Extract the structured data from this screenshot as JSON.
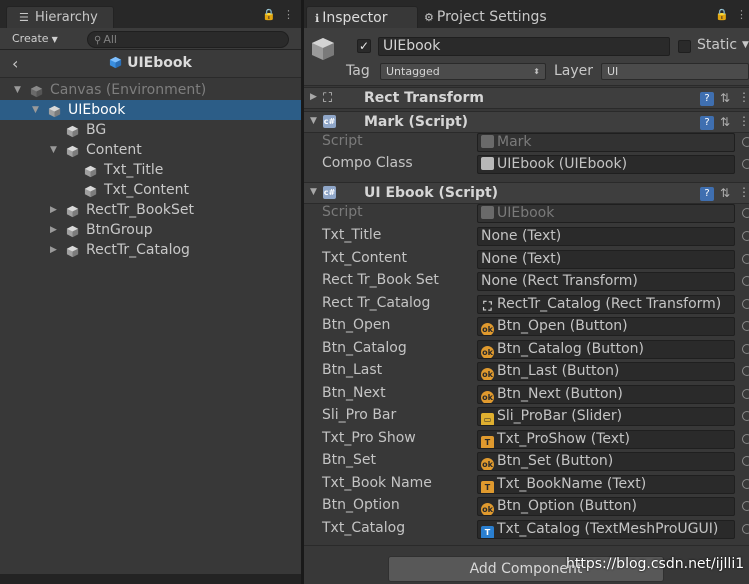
{
  "hierarchy": {
    "tab_label": "Hierarchy",
    "create_label": "Create",
    "search_placeholder": "All",
    "prefab_title": "UIEbook",
    "tree": [
      {
        "label": "Canvas (Environment)",
        "depth": 0,
        "arrow": "▼",
        "dim": true
      },
      {
        "label": "UIEbook",
        "depth": 1,
        "arrow": "▼",
        "selected": true
      },
      {
        "label": "BG",
        "depth": 2,
        "arrow": ""
      },
      {
        "label": "Content",
        "depth": 2,
        "arrow": "▼"
      },
      {
        "label": "Txt_Title",
        "depth": 3,
        "arrow": ""
      },
      {
        "label": "Txt_Content",
        "depth": 3,
        "arrow": ""
      },
      {
        "label": "RectTr_BookSet",
        "depth": 2,
        "arrow": "▶"
      },
      {
        "label": "BtnGroup",
        "depth": 2,
        "arrow": "▶"
      },
      {
        "label": "RectTr_Catalog",
        "depth": 2,
        "arrow": "▶"
      }
    ]
  },
  "inspector": {
    "tab_inspector": "Inspector",
    "tab_project_settings": "Project Settings",
    "object_name": "UIEbook",
    "static_label": "Static",
    "tag_label": "Tag",
    "tag_value": "Untagged",
    "layer_label": "Layer",
    "layer_value": "UI",
    "components": {
      "rect_transform": "Rect Transform",
      "mark": {
        "title": "Mark (Script)",
        "script_label": "Script",
        "script_value": "Mark",
        "compo_label": "Compo Class",
        "compo_value": "UIEbook (UIEbook)"
      },
      "ui_ebook": {
        "title": "UI Ebook (Script)",
        "script_label": "Script",
        "script_value": "UIEbook",
        "fields": [
          {
            "label": "Txt_Title",
            "value": "None (Text)",
            "icon": ""
          },
          {
            "label": "Txt_Content",
            "value": "None (Text)",
            "icon": ""
          },
          {
            "label": "Rect Tr_Book Set",
            "value": "None (Rect Transform)",
            "icon": ""
          },
          {
            "label": "Rect Tr_Catalog",
            "value": "RectTr_Catalog (Rect Transform)",
            "icon": "rect"
          },
          {
            "label": "Btn_Open",
            "value": "Btn_Open (Button)",
            "icon": "button"
          },
          {
            "label": "Btn_Catalog",
            "value": "Btn_Catalog (Button)",
            "icon": "button"
          },
          {
            "label": "Btn_Last",
            "value": "Btn_Last (Button)",
            "icon": "button"
          },
          {
            "label": "Btn_Next",
            "value": "Btn_Next (Button)",
            "icon": "button"
          },
          {
            "label": "Sli_Pro Bar",
            "value": "Sli_ProBar (Slider)",
            "icon": "slider"
          },
          {
            "label": "Txt_Pro Show",
            "value": "Txt_ProShow (Text)",
            "icon": "text"
          },
          {
            "label": "Btn_Set",
            "value": "Btn_Set (Button)",
            "icon": "button"
          },
          {
            "label": "Txt_Book Name",
            "value": "Txt_BookName (Text)",
            "icon": "text"
          },
          {
            "label": "Btn_Option",
            "value": "Btn_Option (Button)",
            "icon": "button"
          },
          {
            "label": "Txt_Catalog",
            "value": "Txt_Catalog (TextMeshProUGUI)",
            "icon": "tmp"
          }
        ]
      }
    },
    "add_component_label": "Add Component"
  },
  "watermark": "https://blog.csdn.net/ijlli1"
}
